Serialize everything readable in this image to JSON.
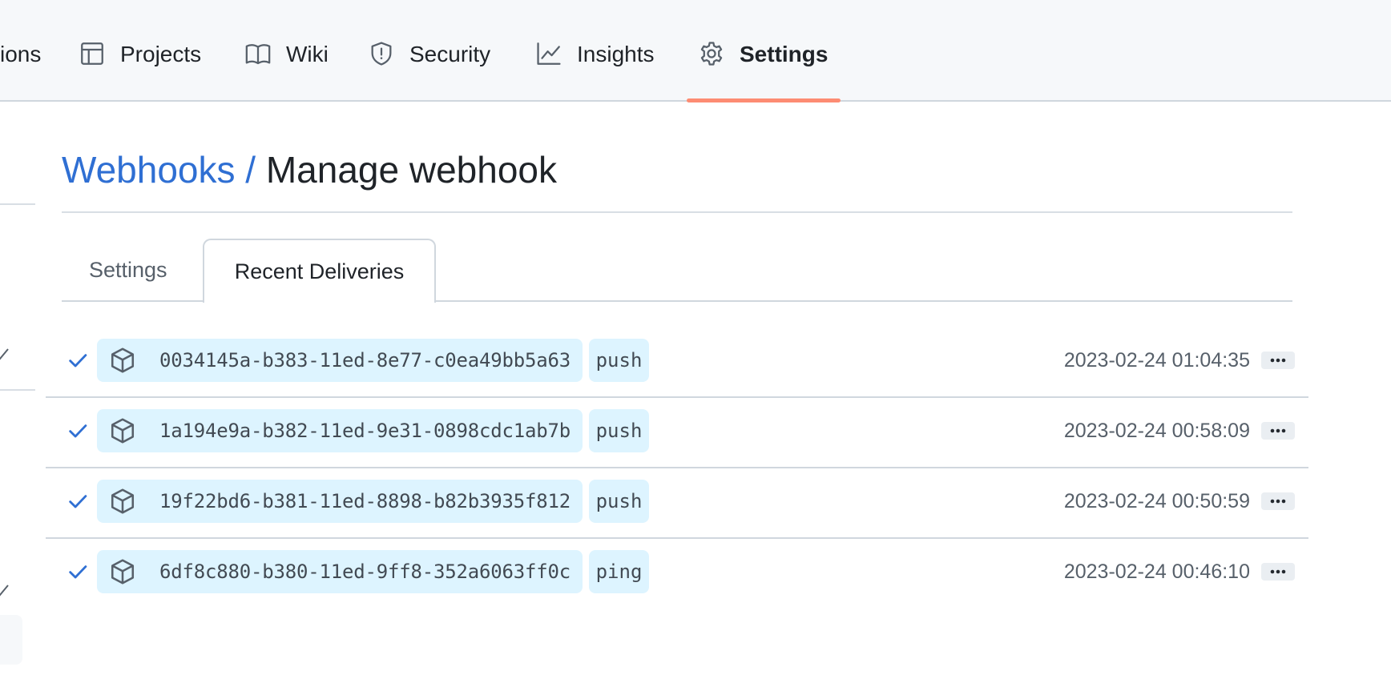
{
  "nav": {
    "items": [
      {
        "label": "ions",
        "icon": "actions-icon"
      },
      {
        "label": "Projects",
        "icon": "table-icon"
      },
      {
        "label": "Wiki",
        "icon": "book-icon"
      },
      {
        "label": "Security",
        "icon": "shield-icon"
      },
      {
        "label": "Insights",
        "icon": "graph-icon"
      },
      {
        "label": "Settings",
        "icon": "gear-icon",
        "selected": true
      }
    ],
    "accent_color": "#fd8c73"
  },
  "breadcrumb": {
    "parent": "Webhooks",
    "separator": "/",
    "current": "Manage webhook"
  },
  "tabs": [
    {
      "label": "Settings",
      "selected": false
    },
    {
      "label": "Recent Deliveries",
      "selected": true
    }
  ],
  "deliveries": [
    {
      "status": "success",
      "icon": "package-icon",
      "guid": "0034145a-b383-11ed-8e77-c0ea49bb5a63",
      "event": "push",
      "timestamp": "2023-02-24 01:04:35"
    },
    {
      "status": "success",
      "icon": "package-icon",
      "guid": "1a194e9a-b382-11ed-9e31-0898cdc1ab7b",
      "event": "push",
      "timestamp": "2023-02-24 00:58:09"
    },
    {
      "status": "success",
      "icon": "package-icon",
      "guid": "19f22bd6-b381-11ed-8898-b82b3935f812",
      "event": "push",
      "timestamp": "2023-02-24 00:50:59"
    },
    {
      "status": "success",
      "icon": "package-icon",
      "guid": "6df8c880-b380-11ed-9ff8-352a6063ff0c",
      "event": "ping",
      "timestamp": "2023-02-24 00:46:10"
    }
  ],
  "colors": {
    "link": "#2f6fd3",
    "pill_background": "#ddf4ff",
    "check": "#2f6fd3"
  }
}
